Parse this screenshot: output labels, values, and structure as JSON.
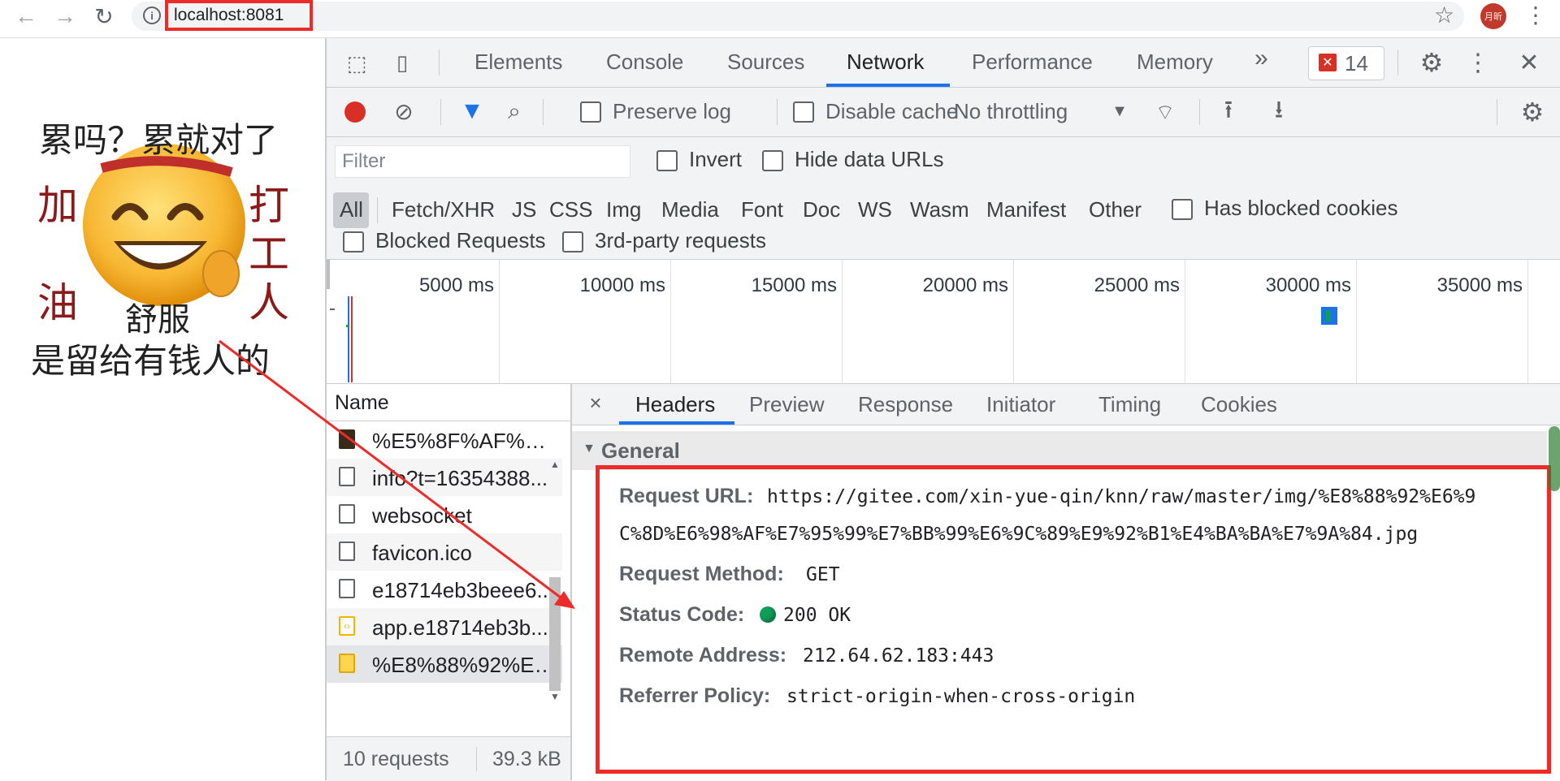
{
  "browser": {
    "url": "localhost:8081",
    "avatar_text": "月昕"
  },
  "page": {
    "meme_lines": [
      "累吗？累就对了",
      "加",
      "油",
      "打",
      "工",
      "人",
      "舒服",
      "是留给有钱人的"
    ]
  },
  "devtools": {
    "tabs": [
      "Elements",
      "Console",
      "Sources",
      "Network",
      "Performance",
      "Memory"
    ],
    "more_tabs": "»",
    "error_count": "14",
    "toolbar": {
      "preserve_log": "Preserve log",
      "disable_cache": "Disable cache",
      "throttling": "No throttling"
    },
    "filter": {
      "placeholder": "Filter",
      "invert": "Invert",
      "hide_data_urls": "Hide data URLs",
      "types": [
        "All",
        "Fetch/XHR",
        "JS",
        "CSS",
        "Img",
        "Media",
        "Font",
        "Doc",
        "WS",
        "Wasm",
        "Manifest",
        "Other"
      ],
      "has_blocked_cookies": "Has blocked cookies",
      "blocked_requests": "Blocked Requests",
      "third_party": "3rd-party requests"
    },
    "overview": {
      "ticks": [
        "5000 ms",
        "10000 ms",
        "15000 ms",
        "20000 ms",
        "25000 ms",
        "30000 ms",
        "35000 ms"
      ]
    },
    "requests": {
      "header": "Name",
      "rows": [
        "%E5%8F%AF%E7...",
        "info?t=16354388...",
        "websocket",
        "favicon.ico",
        "e18714eb3beee6...",
        "app.e18714eb3b...",
        "%E8%88%92%E6..."
      ],
      "count": "10 requests",
      "size": "39.3 kB"
    },
    "details": {
      "close": "×",
      "tabs": [
        "Headers",
        "Preview",
        "Response",
        "Initiator",
        "Timing",
        "Cookies"
      ],
      "general_title": "General",
      "fields": [
        {
          "key": "Request URL:",
          "value": "https://gitee.com/xin-yue-qin/knn/raw/master/img/%E8%88%92%E6%9",
          "value2": "C%8D%E6%98%AF%E7%95%99%E7%BB%99%E6%9C%89%E9%92%B1%E4%BA%BA%E7%9A%84.jpg"
        },
        {
          "key": "Request Method:",
          "value": "GET"
        },
        {
          "key": "Status Code:",
          "value": "200 OK"
        },
        {
          "key": "Remote Address:",
          "value": "212.64.62.183:443"
        },
        {
          "key": "Referrer Policy:",
          "value": "strict-origin-when-cross-origin"
        }
      ]
    }
  },
  "colors": {
    "accent": "#1a73e8",
    "highlight": "#ee2b2b",
    "record": "#d93025",
    "status_ok": "#0f9d58"
  }
}
